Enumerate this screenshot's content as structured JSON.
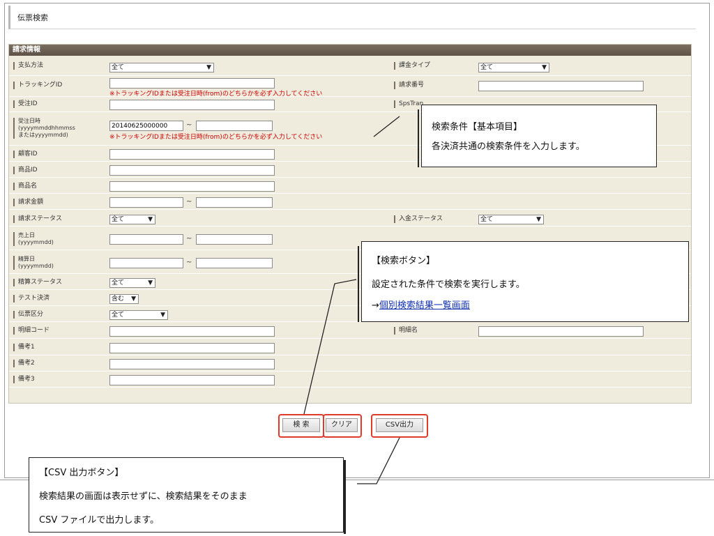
{
  "page": {
    "title": "伝票検索"
  },
  "panel": {
    "title": "請求情報"
  },
  "form": {
    "payment_method": {
      "label": "支払方法",
      "value": "全て"
    },
    "billing_type": {
      "label": "課金タイプ",
      "value": "全て"
    },
    "tracking_id": {
      "label": "トラッキングID",
      "value": "",
      "note": "※トラッキングIDまたは受注日時(from)のどちらかを必ず入力してください"
    },
    "invoice_no": {
      "label": "請求番号",
      "value": ""
    },
    "order_id": {
      "label": "受注ID",
      "value": ""
    },
    "sps_tran": {
      "label": "SpsTran"
    },
    "order_datetime": {
      "label_lines": [
        "受注日時",
        "(yyyymmddhhmmss",
        "またはyyyymmdd)"
      ],
      "from": "20140625000000",
      "to": "",
      "tilde": "~",
      "note": "※トラッキングIDまたは受注日時(from)のどちらかを必ず入力してください"
    },
    "customer_id": {
      "label": "顧客ID",
      "value": ""
    },
    "product_id": {
      "label": "商品ID",
      "value": ""
    },
    "product_name": {
      "label": "商品名",
      "value": ""
    },
    "billing_amount": {
      "label": "請求金額",
      "from": "",
      "to": "",
      "tilde": "~"
    },
    "billing_status": {
      "label": "請求ステータス",
      "value": "全て"
    },
    "payment_status": {
      "label": "入金ステータス",
      "value": "全て"
    },
    "sales_date": {
      "label_lines": [
        "売上日",
        "(yyyymmdd)"
      ],
      "from": "",
      "to": "",
      "tilde": "~"
    },
    "settlement_date": {
      "label_lines": [
        "精算日",
        "(yyyymmdd)"
      ],
      "from": "",
      "to": "",
      "tilde": "~"
    },
    "settlement_status": {
      "label": "精算ステータス",
      "value": "全て"
    },
    "test_payment": {
      "label": "テスト決済",
      "value": "含む"
    },
    "slip_type": {
      "label": "伝票区分",
      "value": "全て"
    },
    "detail_code": {
      "label": "明細コード",
      "value": ""
    },
    "detail_name": {
      "label": "明細名",
      "value": ""
    },
    "remark1": {
      "label": "備考1",
      "value": ""
    },
    "remark2": {
      "label": "備考2",
      "value": ""
    },
    "remark3": {
      "label": "備考3",
      "value": ""
    }
  },
  "buttons": {
    "search": "検 索",
    "clear": "クリア",
    "csv": "CSV出力"
  },
  "callouts": {
    "basic": {
      "line1": "検索条件【基本項目】",
      "line2": "各決済共通の検索条件を入力します。"
    },
    "search": {
      "line1": "【検索ボタン】",
      "line2": "設定された条件で検索を実行します。",
      "arrow": "→",
      "link": "個別検索結果一覧画面"
    },
    "csv": {
      "line1": "【CSV 出力ボタン】",
      "line2": "検索結果の画面は表示せずに、検索結果をそのまま",
      "line3": "CSV ファイルで出力します。"
    }
  },
  "icons": {
    "dropdown": "chevron-down-icon"
  },
  "colors": {
    "panel_bg": "#efebdd",
    "title_bar": "#6a5e52",
    "highlight": "#e03a2a",
    "note": "#cc0000",
    "link": "#1030b0"
  }
}
